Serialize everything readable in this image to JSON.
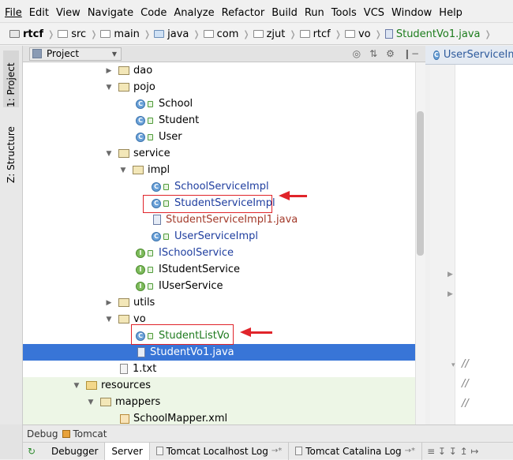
{
  "menu": [
    "File",
    "Edit",
    "View",
    "Navigate",
    "Code",
    "Analyze",
    "Refactor",
    "Build",
    "Run",
    "Tools",
    "VCS",
    "Window",
    "Help"
  ],
  "breadcrumb": [
    "rtcf",
    "src",
    "main",
    "java",
    "com",
    "zjut",
    "rtcf",
    "vo",
    "StudentVo1.java"
  ],
  "left_tabs": {
    "project": "1: Project",
    "structure": "Z: Structure"
  },
  "project_panel": {
    "title": "Project"
  },
  "editor": {
    "tab_label": "UserServiceImpl",
    "comment": "//"
  },
  "tree": [
    {
      "label": "dao",
      "kind": "folder",
      "expanded": false
    },
    {
      "label": "pojo",
      "kind": "folder",
      "expanded": true
    },
    {
      "label": "School",
      "kind": "class"
    },
    {
      "label": "Student",
      "kind": "class"
    },
    {
      "label": "User",
      "kind": "class"
    },
    {
      "label": "service",
      "kind": "folder",
      "expanded": true
    },
    {
      "label": "impl",
      "kind": "folder",
      "expanded": true
    },
    {
      "label": "SchoolServiceImpl",
      "kind": "class"
    },
    {
      "label": "StudentServiceImpl",
      "kind": "class"
    },
    {
      "label": "StudentServiceImpl1.java",
      "kind": "java-file"
    },
    {
      "label": "UserServiceImpl",
      "kind": "class"
    },
    {
      "label": "ISchoolService",
      "kind": "interface"
    },
    {
      "label": "IStudentService",
      "kind": "interface"
    },
    {
      "label": "IUserService",
      "kind": "interface"
    },
    {
      "label": "utils",
      "kind": "folder",
      "expanded": false
    },
    {
      "label": "vo",
      "kind": "folder",
      "expanded": true
    },
    {
      "label": "StudentListVo",
      "kind": "class"
    },
    {
      "label": "StudentVo1.java",
      "kind": "java-file",
      "selected": true
    },
    {
      "label": "1.txt",
      "kind": "text-file"
    },
    {
      "label": "resources",
      "kind": "resource-folder",
      "expanded": true
    },
    {
      "label": "mappers",
      "kind": "folder",
      "expanded": true
    },
    {
      "label": "SchoolMapper.xml",
      "kind": "xml-file"
    }
  ],
  "bottom": {
    "debug_label": "Debug",
    "run_config": "Tomcat",
    "tabs": [
      "Debugger",
      "Server",
      "Tomcat Localhost Log",
      "Tomcat Catalina Log"
    ]
  },
  "colors": {
    "selection": "#3875d7",
    "annotation": "#e0242a"
  }
}
